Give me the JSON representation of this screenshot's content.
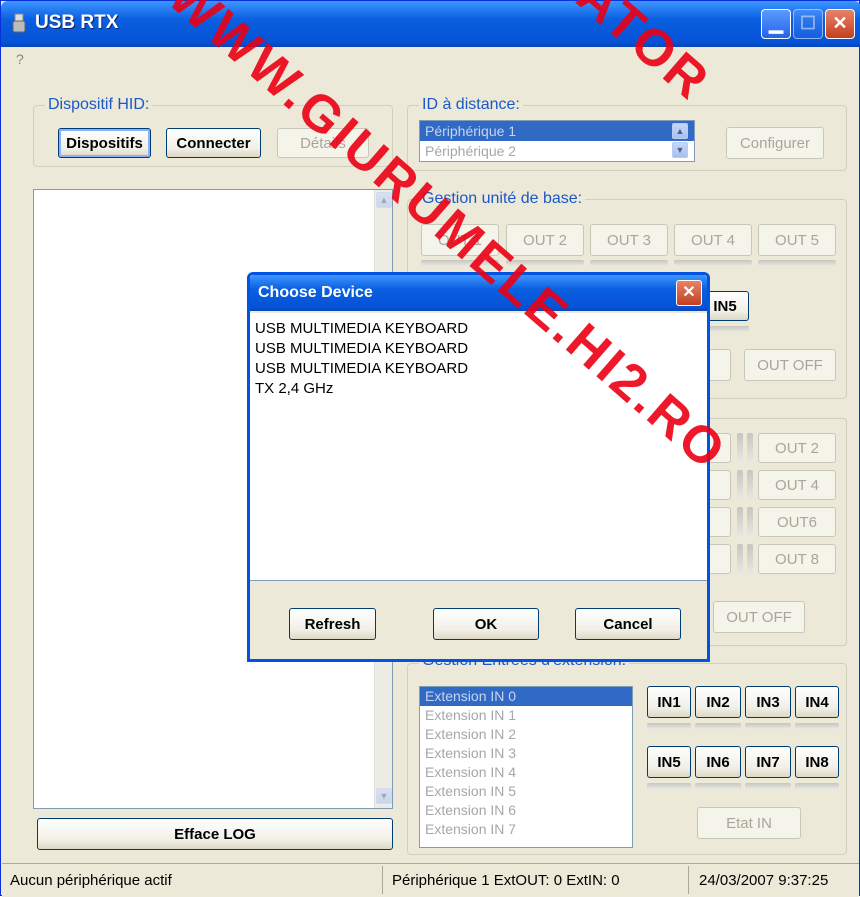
{
  "window": {
    "title": "USB RTX",
    "minimize_icon": "minimize-icon",
    "maximize_icon": "maximize-icon",
    "close_icon": "close-icon",
    "close_glyph": "✕",
    "min_glyph": "▁",
    "max_glyph": "☐"
  },
  "menu": {
    "help": "?"
  },
  "hid": {
    "label": "Dispositif HID:",
    "devices": "Dispositifs",
    "connect": "Connecter",
    "details": "Détails"
  },
  "remote": {
    "label": "ID à distance:",
    "items": [
      "Périphérique 1",
      "Périphérique 2"
    ],
    "configure": "Configurer"
  },
  "base": {
    "label": "Gestion unité de base:",
    "outs": [
      "OUT 1",
      "OUT 2",
      "OUT 3",
      "OUT 4",
      "OUT 5"
    ],
    "in5": "IN5",
    "out_off": "OUT OFF"
  },
  "ext_out": {
    "outs": [
      "OUT 2",
      "OUT 4",
      "OUT6",
      "OUT 8"
    ],
    "out_off": "OUT OFF"
  },
  "ext_in": {
    "label": "Gestion Entrées d'extension:",
    "items": [
      "Extension IN 0",
      "Extension IN 1",
      "Extension IN 2",
      "Extension IN 3",
      "Extension IN 4",
      "Extension IN 5",
      "Extension IN 6",
      "Extension IN 7"
    ],
    "ins": [
      "IN1",
      "IN2",
      "IN3",
      "IN4",
      "IN5",
      "IN6",
      "IN7",
      "IN8"
    ],
    "etat": "Etat IN"
  },
  "log": {
    "clear": "Efface LOG"
  },
  "status": {
    "left": "Aucun périphérique actif",
    "mid": "Périphérique 1 ExtOUT: 0 ExtIN: 0",
    "time": "24/03/2007 9:37:25"
  },
  "dialog": {
    "title": "Choose Device",
    "close_glyph": "✕",
    "items": [
      "USB MULTIMEDIA KEYBOARD",
      "USB MULTIMEDIA KEYBOARD",
      "USB MULTIMEDIA KEYBOARD",
      "TX 2,4 GHz"
    ],
    "refresh": "Refresh",
    "ok": "OK",
    "cancel": "Cancel"
  },
  "watermark": "WWW.GIURUMELE.HI2.RO",
  "watermark2": "ATOR",
  "colors": {
    "accent": "#1b58c7",
    "titlebar": "#0a5fe0",
    "watermark": "#eb0014"
  }
}
